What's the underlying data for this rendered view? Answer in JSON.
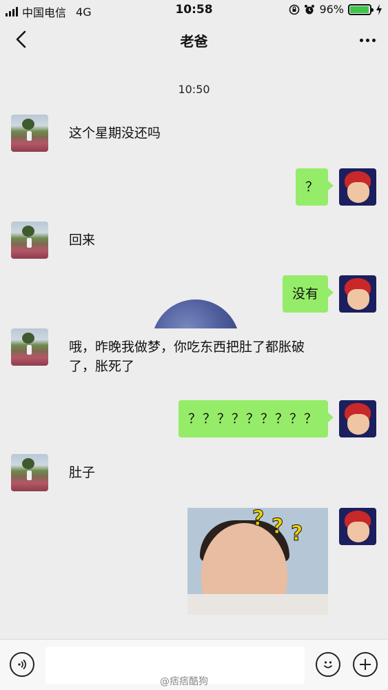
{
  "status_bar": {
    "carrier": "中国电信",
    "network": "4G",
    "time": "10:58",
    "battery_percent": "96%",
    "battery_level": 0.96
  },
  "header": {
    "title": "老爸"
  },
  "chat": {
    "timestamp": "10:50",
    "messages": [
      {
        "sender": "dad",
        "text": "这个星期没还吗"
      },
      {
        "sender": "me",
        "text": "？"
      },
      {
        "sender": "dad",
        "text": "回来"
      },
      {
        "sender": "me",
        "text": "没有"
      },
      {
        "sender": "dad",
        "text": "哦，昨晚我做梦，你吃东西把肚了都胀破了，胀死了"
      },
      {
        "sender": "me",
        "text": "？？？？？？？？？"
      },
      {
        "sender": "dad",
        "text": "肚子"
      },
      {
        "sender": "me",
        "type": "sticker",
        "sticker_text": [
          "?",
          "?",
          "?"
        ]
      }
    ]
  },
  "bottom_bar": {
    "input_value": "",
    "watermark": "@痞痞酷狗"
  },
  "colors": {
    "out_bubble": "#95ec69",
    "background": "#ededed",
    "battery": "#3dc64b"
  }
}
